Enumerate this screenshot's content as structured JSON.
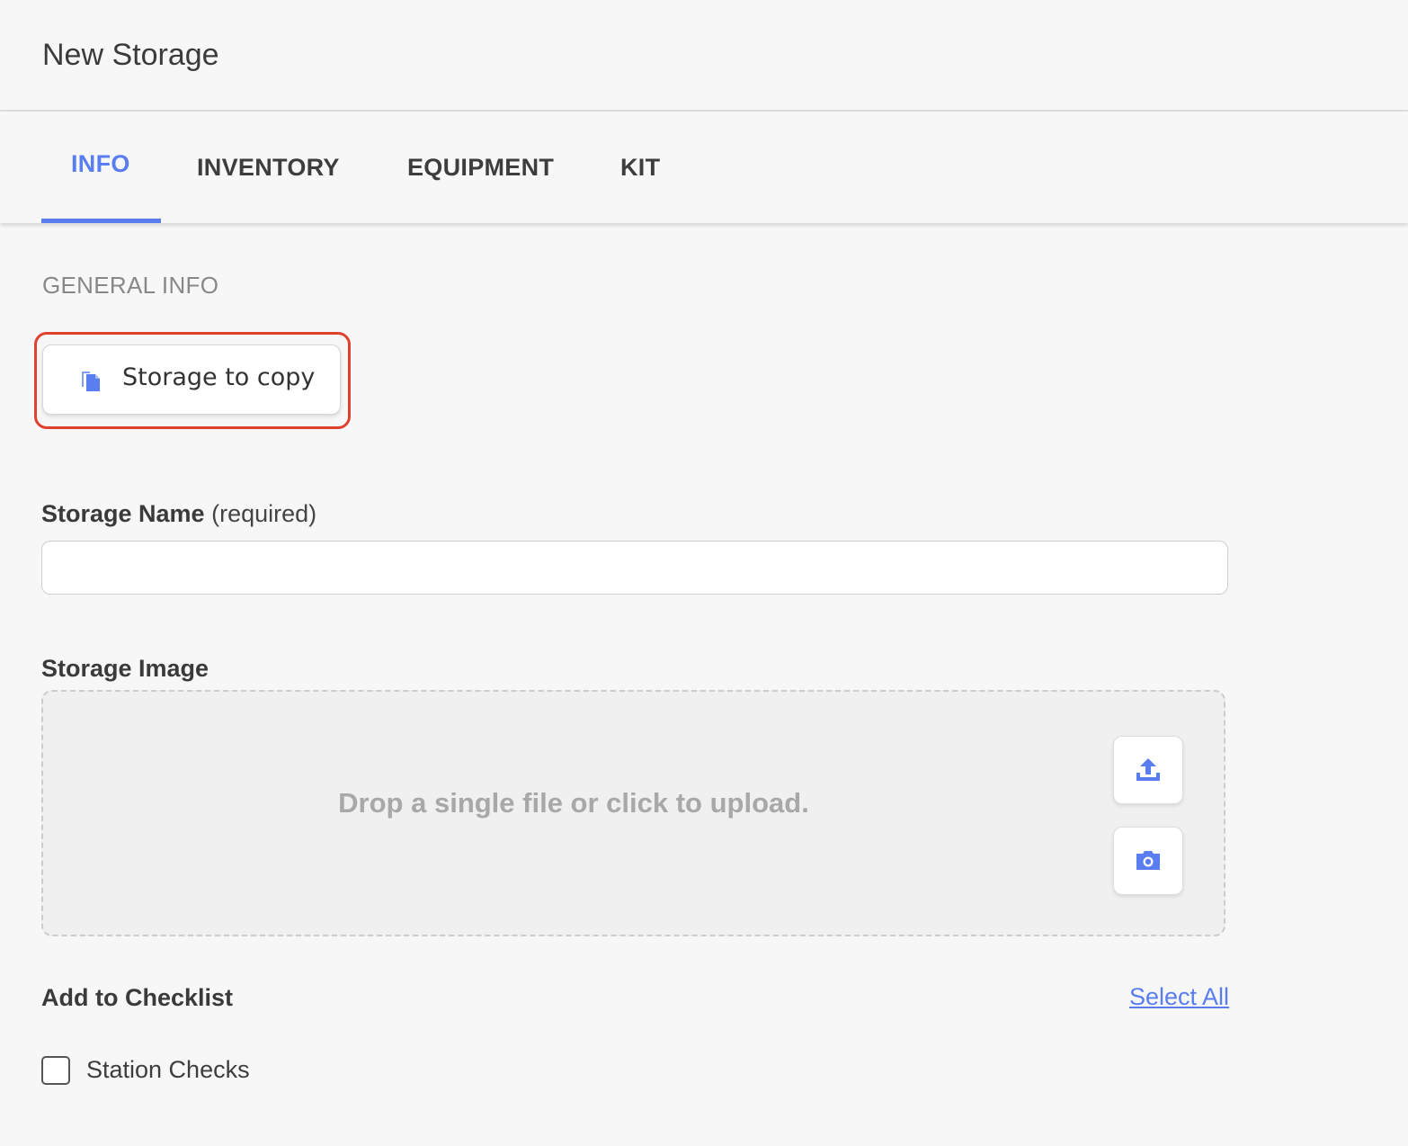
{
  "header": {
    "title": "New Storage"
  },
  "tabs": [
    {
      "label": "INFO",
      "active": true
    },
    {
      "label": "INVENTORY",
      "active": false
    },
    {
      "label": "EQUIPMENT",
      "active": false
    },
    {
      "label": "KIT",
      "active": false
    }
  ],
  "general_info": {
    "section_title": "GENERAL INFO",
    "copy_button_label": "Storage to copy",
    "copy_button_icon": "copy-icon"
  },
  "storage_name": {
    "label": "Storage Name",
    "label_suffix": "(required)",
    "value": "",
    "placeholder": ""
  },
  "storage_image": {
    "label": "Storage Image",
    "dropzone_text": "Drop a single file or click to upload.",
    "upload_icon": "upload-icon",
    "camera_icon": "camera-icon"
  },
  "checklist": {
    "label": "Add to Checklist",
    "select_all_label": "Select All",
    "items": [
      {
        "label": "Station Checks",
        "checked": false
      }
    ]
  },
  "colors": {
    "accent": "#5a7ef0",
    "highlight_ring": "#e0412e",
    "background": "#f7f7f7"
  }
}
